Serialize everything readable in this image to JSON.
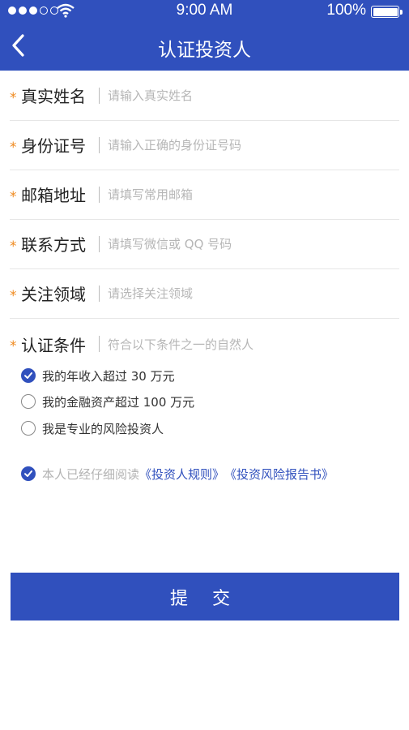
{
  "status_bar": {
    "time": "9:00 AM",
    "battery": "100%"
  },
  "header": {
    "title": "认证投资人"
  },
  "form": {
    "required_mark": "*",
    "fields": [
      {
        "label": "真实姓名",
        "placeholder": "请输入真实姓名"
      },
      {
        "label": "身份证号",
        "placeholder": "请输入正确的身份证号码"
      },
      {
        "label": "邮箱地址",
        "placeholder": "请填写常用邮箱"
      },
      {
        "label": "联系方式",
        "placeholder": "请填写微信或 QQ 号码"
      },
      {
        "label": "关注领域",
        "placeholder": "请选择关注领域"
      },
      {
        "label": "认证条件",
        "placeholder": "符合以下条件之一的自然人"
      }
    ],
    "conditions": [
      {
        "text": "我的年收入超过 30 万元",
        "checked": true
      },
      {
        "text": "我的金融资产超过 100 万元",
        "checked": false
      },
      {
        "text": "我是专业的风险投资人",
        "checked": false
      }
    ],
    "agreement": {
      "prefix": "本人已经仔细阅读",
      "link1": "《投资人规则》",
      "link2": "《投资风险报告书》",
      "checked": true
    },
    "submit_label": "提 交"
  },
  "colors": {
    "brand": "#3050bd",
    "required": "#ef8a1f",
    "placeholder": "#b6b6b6"
  },
  "icons": {
    "back": "chevron-left-icon",
    "wifi": "wifi-icon",
    "battery": "battery-icon",
    "check": "check-icon"
  }
}
